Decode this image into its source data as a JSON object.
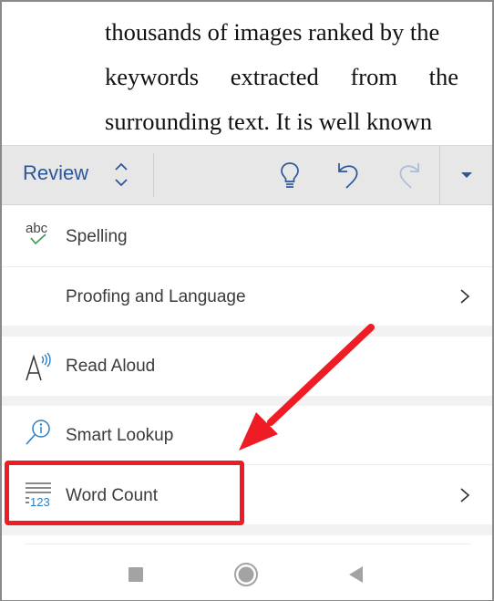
{
  "document": {
    "lines": [
      "thousands of images ranked by the",
      [
        "keywords",
        "extracted",
        "from",
        "the"
      ],
      "surrounding text. It is well known"
    ]
  },
  "toolbar": {
    "tab_label": "Review",
    "tab_switch_icon": "chevron-up-down-icon",
    "buttons": [
      {
        "name": "tell-me-button",
        "icon": "lightbulb-icon"
      },
      {
        "name": "undo-button",
        "icon": "undo-icon"
      },
      {
        "name": "redo-button",
        "icon": "redo-icon",
        "disabled": true
      },
      {
        "name": "more-options-button",
        "icon": "caret-down-icon"
      }
    ],
    "accent_color": "#2b579a"
  },
  "menu": {
    "items": [
      {
        "label": "Spelling",
        "icon": "spelling-check-icon",
        "icon_text": "abc",
        "has_submenu": false
      },
      {
        "label": "Proofing and Language",
        "icon": null,
        "has_submenu": true
      },
      {
        "label": "Read Aloud",
        "icon": "read-aloud-icon",
        "icon_text": "A",
        "has_submenu": false
      },
      {
        "label": "Smart Lookup",
        "icon": "smart-lookup-icon",
        "has_submenu": false
      },
      {
        "label": "Word Count",
        "icon": "word-count-icon",
        "icon_text": "123",
        "has_submenu": true,
        "highlighted": true
      }
    ]
  },
  "nav": {
    "buttons": [
      {
        "name": "recents-button",
        "icon": "square-icon"
      },
      {
        "name": "home-button",
        "icon": "circle-icon"
      },
      {
        "name": "back-button",
        "icon": "triangle-back-icon"
      }
    ]
  },
  "annotation": {
    "color": "#ee1c25",
    "target": "Word Count"
  }
}
